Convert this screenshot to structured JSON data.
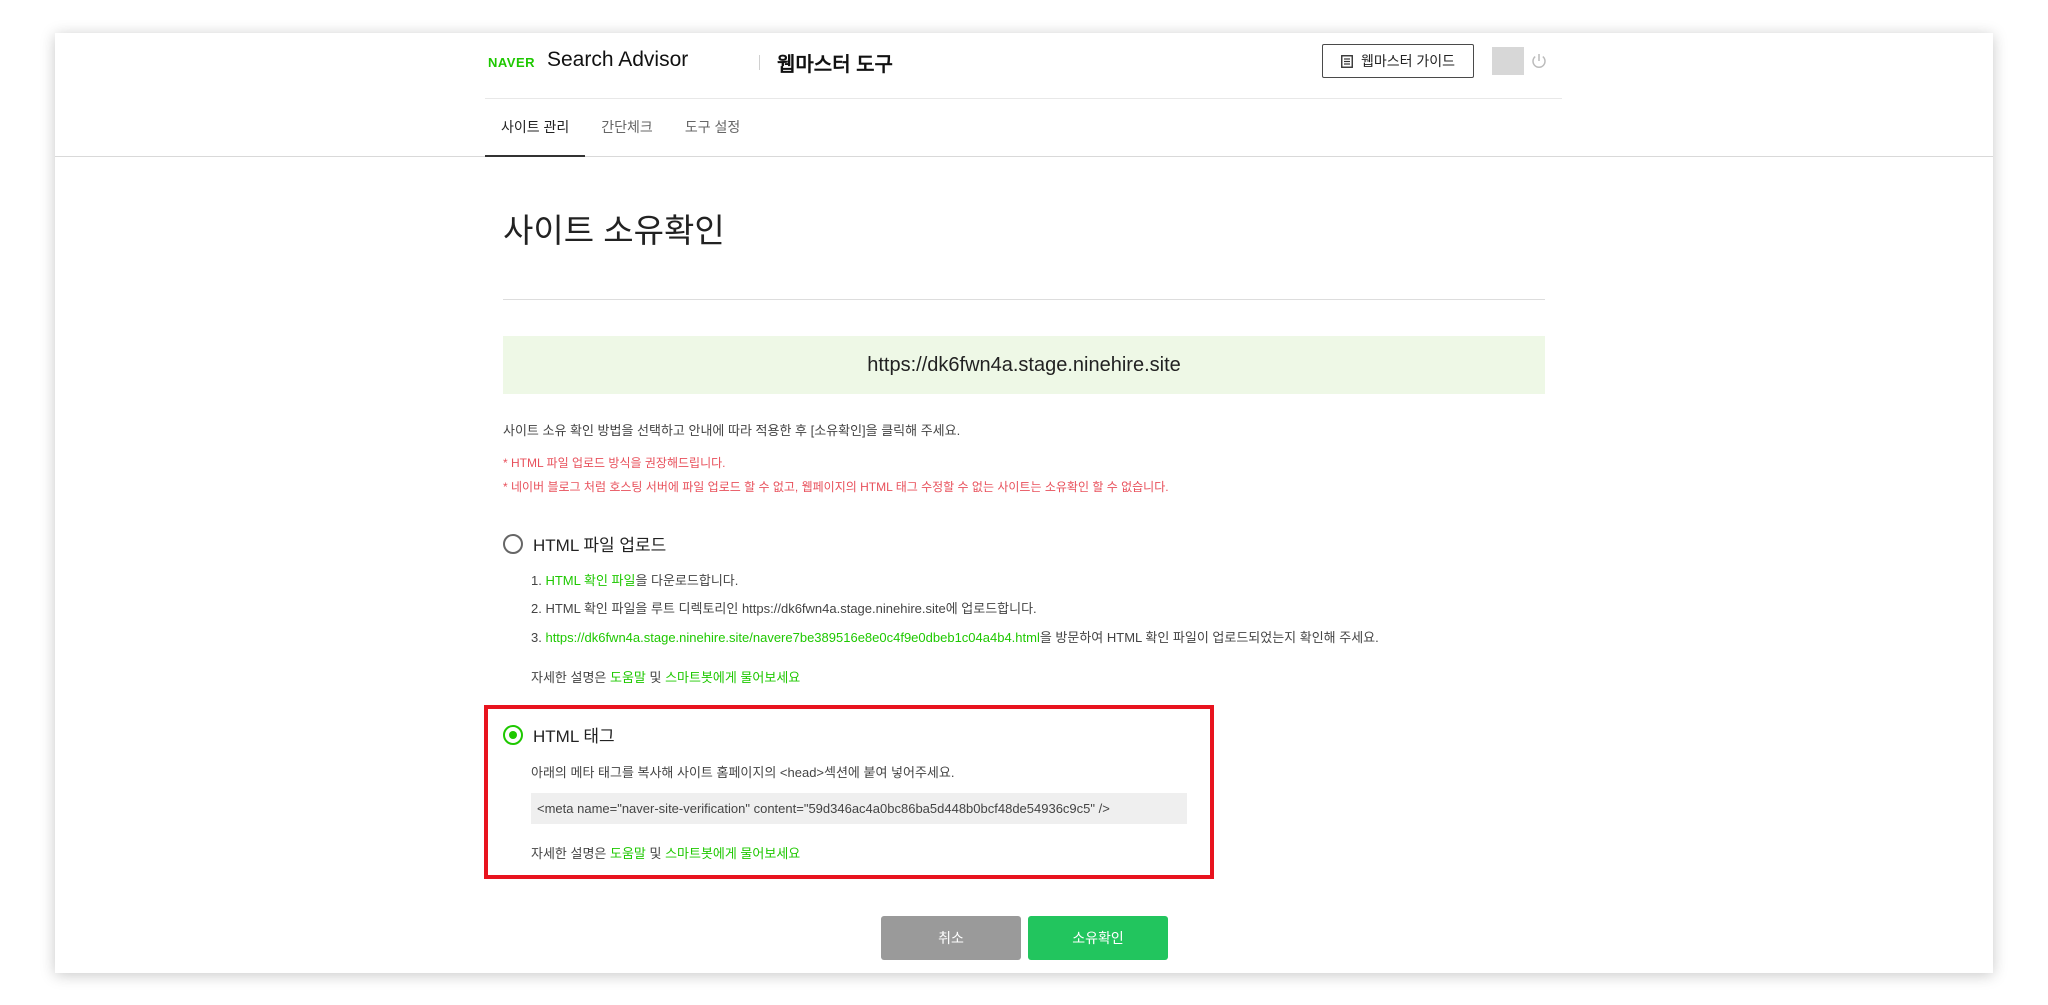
{
  "header": {
    "brand": "NAVER",
    "product": "Search Advisor",
    "tool": "웹마스터 도구",
    "guide_label": "웹마스터 가이드",
    "tabs": [
      {
        "label": "사이트 관리"
      },
      {
        "label": "간단체크"
      },
      {
        "label": "도구 설정"
      }
    ]
  },
  "main": {
    "title": "사이트 소유확인",
    "site_url": "https://dk6fwn4a.stage.ninehire.site",
    "intro": "사이트 소유 확인 방법을 선택하고 안내에 따라 적용한 후 [소유확인]을 클릭해 주세요.",
    "notices": [
      "* HTML 파일 업로드 방식을 권장해드립니다.",
      "* 네이버 블로그 처럼 호스팅 서버에 파일 업로드 할 수 없고, 웹페이지의 HTML 태그 수정할 수 없는 사이트는 소유확인 할 수 없습니다."
    ],
    "option_file": {
      "label": "HTML 파일 업로드",
      "selected": false,
      "step1_prefix": "1. ",
      "step1_link": "HTML 확인 파일",
      "step1_suffix": "을 다운로드합니다.",
      "step2": "2. HTML 확인 파일을 루트 디렉토리인 https://dk6fwn4a.stage.ninehire.site에 업로드합니다.",
      "step3_prefix": "3. ",
      "step3_link": "https://dk6fwn4a.stage.ninehire.site/navere7be389516e8e0c4f9e0dbeb1c04a4b4.html",
      "step3_suffix": "을 방문하여 HTML 확인 파일이 업로드되었는지 확인해 주세요.",
      "help_prefix": "자세한 설명은 ",
      "help_link1": "도움말",
      "help_mid": " 및 ",
      "help_link2": "스마트봇에게 물어보세요"
    },
    "option_tag": {
      "label": "HTML 태그",
      "selected": true,
      "description": "아래의 메타 태그를 복사해 사이트 홈페이지의 <head>섹션에 붙여 넣어주세요.",
      "meta_tag": "<meta name=\"naver-site-verification\" content=\"59d346ac4a0bc86ba5d448b0bcf48de54936c9c5\" />",
      "help_prefix": "자세한 설명은 ",
      "help_link1": "도움말",
      "help_mid": " 및 ",
      "help_link2": "스마트봇에게 물어보세요"
    },
    "cancel_label": "취소",
    "confirm_label": "소유확인"
  },
  "colors": {
    "brand_green": "#1ec800",
    "notice_red": "#e8505b",
    "highlight_border": "#e8131e",
    "confirm_button": "#22c55e",
    "cancel_button": "#9a9a9a",
    "url_background": "#eef8e6"
  }
}
